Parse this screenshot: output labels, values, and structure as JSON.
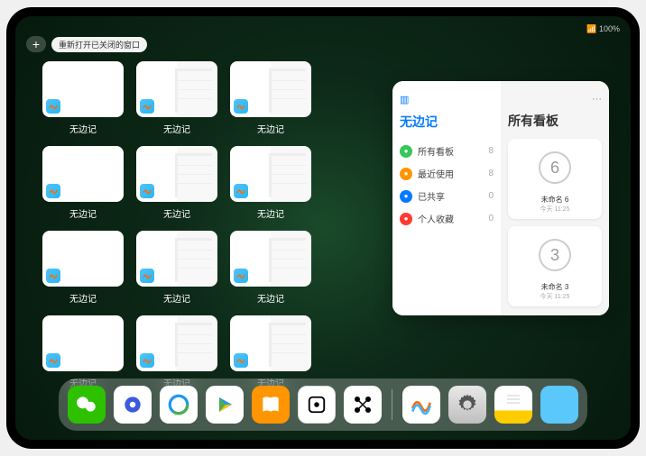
{
  "status": {
    "time": "",
    "battery": "100%"
  },
  "topbar": {
    "plus_label": "+",
    "reopen_label": "重新打开已关闭的窗口"
  },
  "windows": [
    {
      "label": "无边记",
      "variant": "plain"
    },
    {
      "label": "无边记",
      "variant": "split"
    },
    {
      "label": "无边记",
      "variant": "split"
    },
    {
      "label": "无边记",
      "variant": "plain"
    },
    {
      "label": "无边记",
      "variant": "split"
    },
    {
      "label": "无边记",
      "variant": "split"
    },
    {
      "label": "无边记",
      "variant": "plain"
    },
    {
      "label": "无边记",
      "variant": "split"
    },
    {
      "label": "无边记",
      "variant": "split"
    },
    {
      "label": "无边记",
      "variant": "plain"
    },
    {
      "label": "无边记",
      "variant": "split"
    },
    {
      "label": "无边记",
      "variant": "split"
    }
  ],
  "panel": {
    "left_title": "无边记",
    "right_title": "所有看板",
    "more": "···",
    "items": [
      {
        "icon_color": "#34c759",
        "label": "所有看板",
        "count": "8"
      },
      {
        "icon_color": "#ff9500",
        "label": "最近使用",
        "count": "8"
      },
      {
        "icon_color": "#007aff",
        "label": "已共享",
        "count": "0"
      },
      {
        "icon_color": "#ff3b30",
        "label": "个人收藏",
        "count": "0"
      }
    ],
    "boards": [
      {
        "digit": "6",
        "name": "未命名 6",
        "date": "今天 11:25"
      },
      {
        "digit": "3",
        "name": "未命名 3",
        "date": "今天 11:25"
      }
    ]
  },
  "dock": {
    "apps": [
      {
        "name": "wechat",
        "class": "icon-wechat"
      },
      {
        "name": "quark",
        "class": "icon-q1"
      },
      {
        "name": "qqbrowser",
        "class": "icon-q2"
      },
      {
        "name": "play",
        "class": "icon-play"
      },
      {
        "name": "books",
        "class": "icon-books"
      },
      {
        "name": "dice",
        "class": "icon-dice"
      },
      {
        "name": "nodes",
        "class": "icon-nodes"
      }
    ],
    "recent": [
      {
        "name": "freeform",
        "class": "icon-freeform"
      },
      {
        "name": "settings",
        "class": "icon-settings"
      },
      {
        "name": "notes",
        "class": "icon-notes"
      },
      {
        "name": "app-library",
        "class": "icon-library"
      }
    ]
  }
}
